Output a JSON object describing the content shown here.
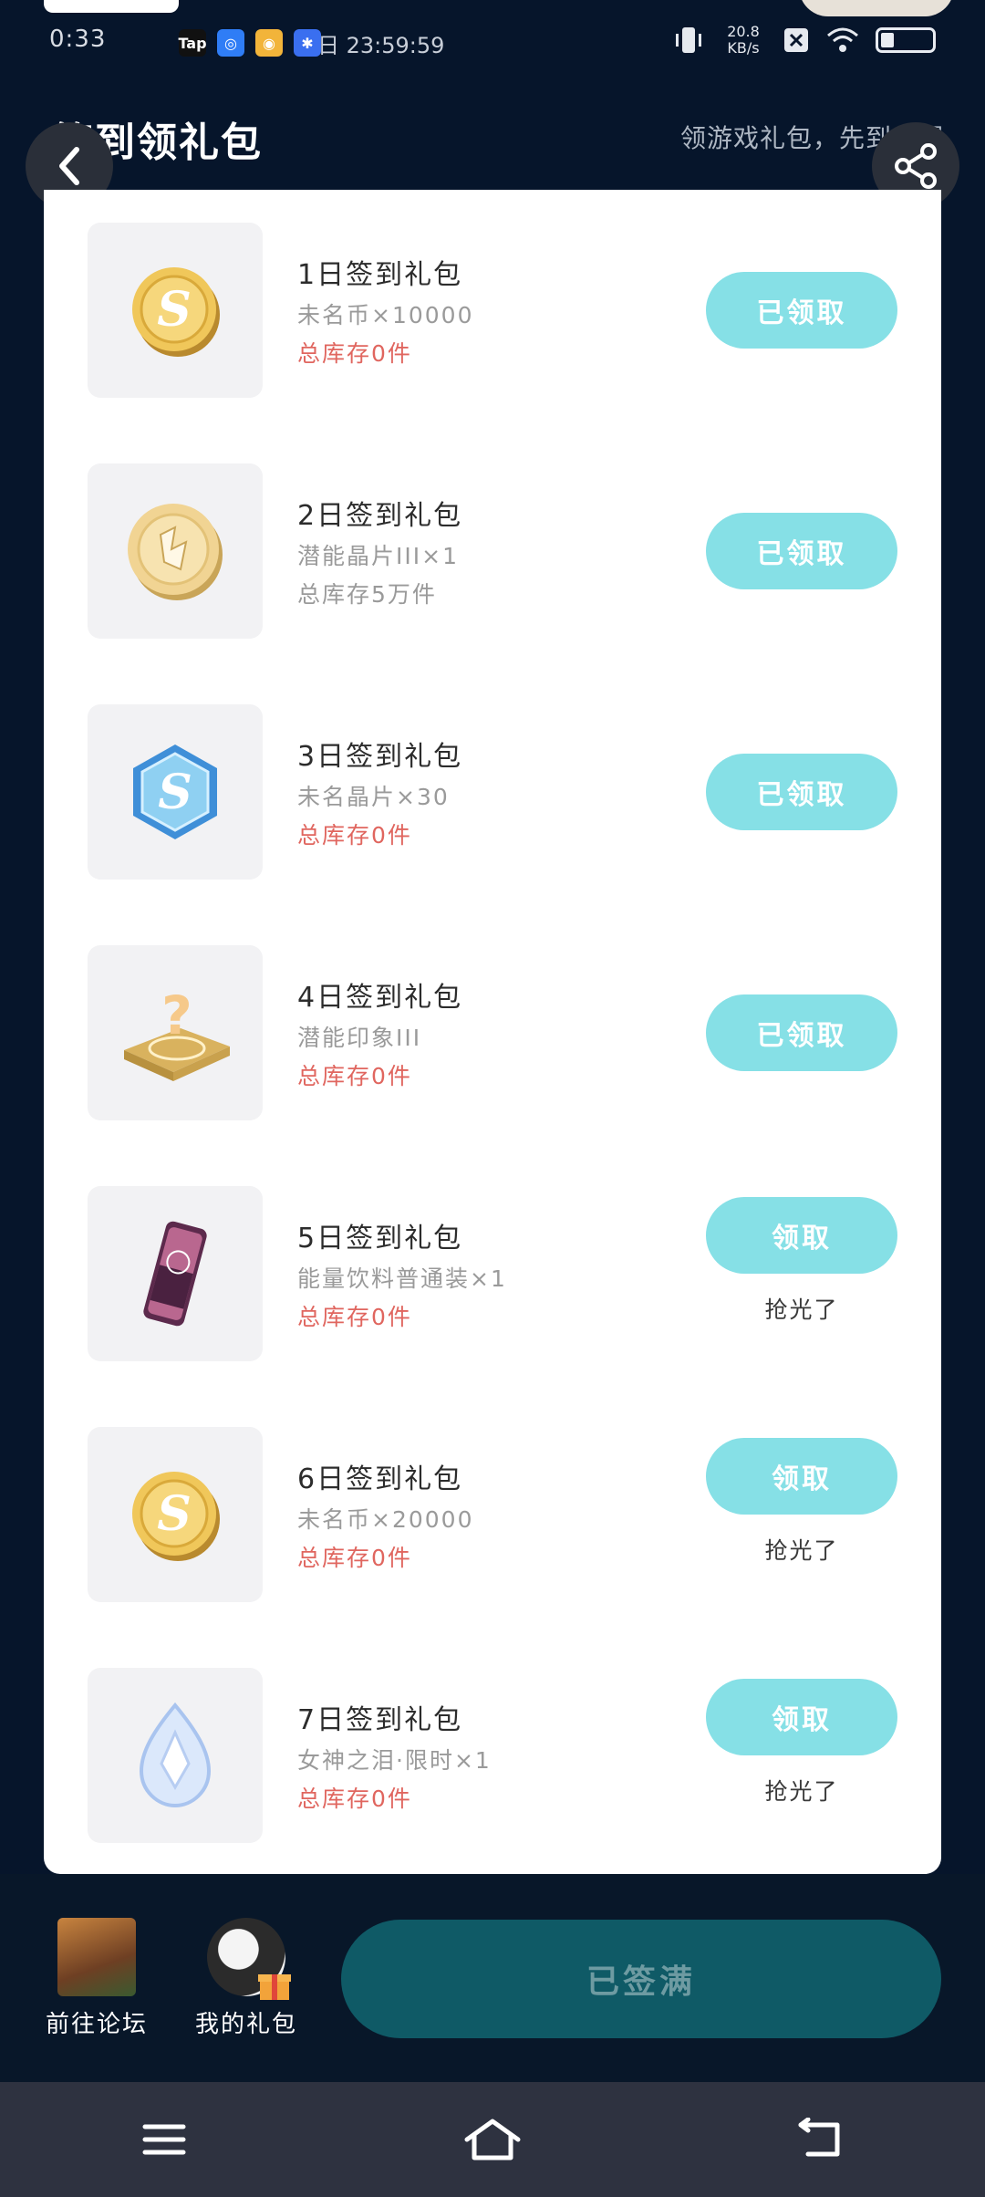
{
  "status_bar": {
    "time": "0:33",
    "date": "日 23:59:59",
    "network_speed": "20.8 KB/s",
    "app_badges": [
      "Tap",
      "QQ",
      "Weibo",
      "Baidu"
    ]
  },
  "header": {
    "title": "签到领礼包",
    "subtitle": "领游戏礼包，先到先得"
  },
  "gifts": [
    {
      "title": "1日签到礼包",
      "reward": "未名币×10000",
      "stock": "总库存0件",
      "button": "已领取",
      "sold_out": "",
      "icon": "gold-coin-icon"
    },
    {
      "title": "2日签到礼包",
      "reward": "潜能晶片III×1",
      "stock": "总库存5万件",
      "button": "已领取",
      "sold_out": "",
      "icon": "potential-chip-icon"
    },
    {
      "title": "3日签到礼包",
      "reward": "未名晶片×30",
      "stock": "总库存0件",
      "button": "已领取",
      "sold_out": "",
      "icon": "crystal-hexagon-icon"
    },
    {
      "title": "4日签到礼包",
      "reward": "潜能印象III",
      "stock": "总库存0件",
      "button": "已领取",
      "sold_out": "",
      "icon": "mystery-impression-icon"
    },
    {
      "title": "5日签到礼包",
      "reward": "能量饮料普通装×1",
      "stock": "总库存0件",
      "button": "领取",
      "sold_out": "抢光了",
      "icon": "energy-drink-icon"
    },
    {
      "title": "6日签到礼包",
      "reward": "未名币×20000",
      "stock": "总库存0件",
      "button": "领取",
      "sold_out": "抢光了",
      "icon": "gold-coin-icon"
    },
    {
      "title": "7日签到礼包",
      "reward": "女神之泪·限时×1",
      "stock": "总库存0件",
      "button": "领取",
      "sold_out": "抢光了",
      "icon": "goddess-tear-icon"
    }
  ],
  "bottom": {
    "forum_label": "前往论坛",
    "mygifts_label": "我的礼包",
    "sign_button": "已签满"
  },
  "colors": {
    "background": "#06152b",
    "button": "#86e0e6",
    "stock_red": "#e0665f",
    "sign_button": "#0f5a66"
  }
}
